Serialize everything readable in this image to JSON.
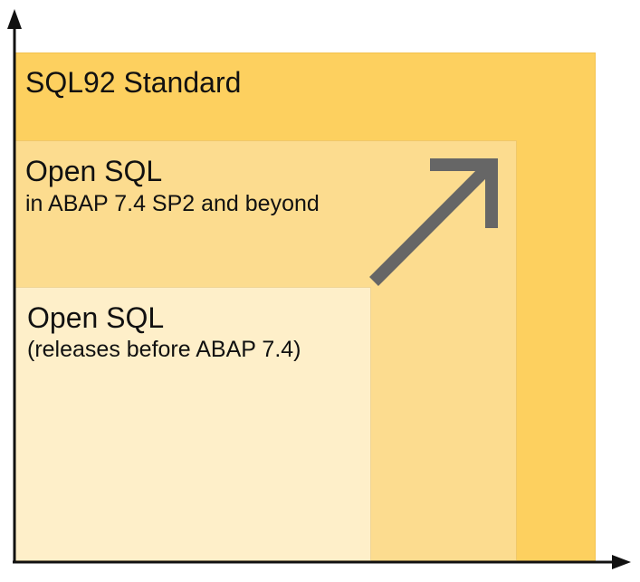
{
  "diagram": {
    "outer_box": {
      "label": "SQL92 Standard",
      "color": "#fdd05f"
    },
    "middle_box": {
      "title": "Open SQL",
      "subtitle": "in ABAP 7.4 SP2 and beyond",
      "color": "#fcdc8f"
    },
    "inner_box": {
      "title": "Open SQL",
      "subtitle": "(releases before ABAP 7.4)",
      "color": "#feefc9"
    },
    "arrow_color": "#666666",
    "axis_color": "#111111"
  }
}
